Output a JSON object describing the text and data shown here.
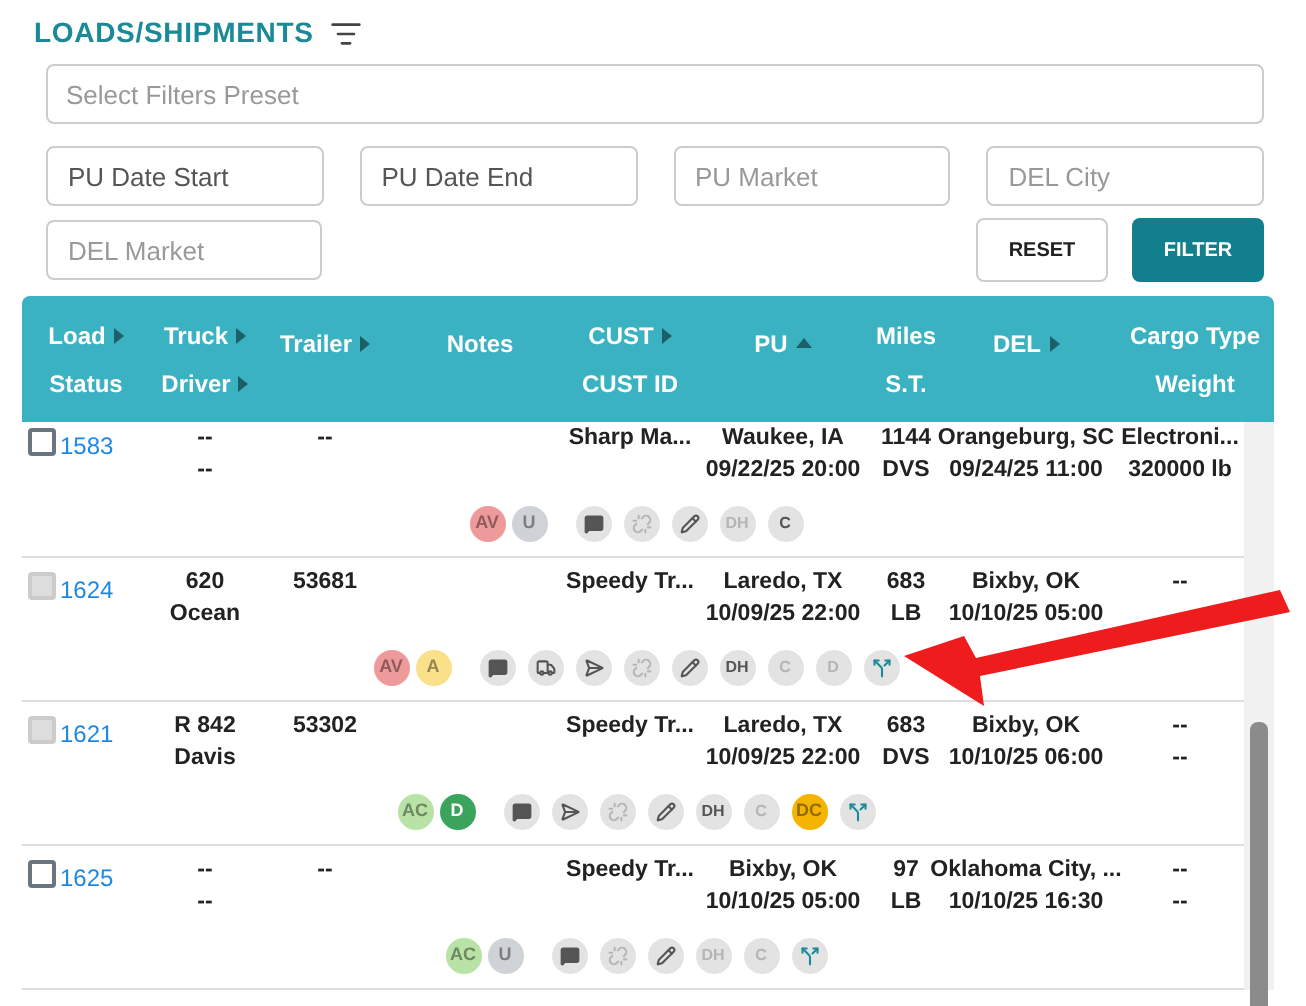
{
  "title": "LOADS/SHIPMENTS",
  "filters": {
    "preset": {
      "placeholder": "Select Filters Preset"
    },
    "fields": [
      {
        "value": "PU Date Start"
      },
      {
        "value": "PU Date End"
      },
      {
        "placeholder": "PU Market"
      },
      {
        "placeholder": "DEL City"
      },
      {
        "placeholder": "DEL Market"
      }
    ],
    "reset": "RESET",
    "filter": "FILTER"
  },
  "columns": [
    {
      "lines": [
        {
          "text": "Load",
          "sortable": true,
          "selected": false
        },
        {
          "text": "Status",
          "sortable": false,
          "selected": false
        }
      ]
    },
    {
      "lines": [
        {
          "text": "Truck",
          "sortable": true,
          "selected": false
        },
        {
          "text": "Driver",
          "sortable": true,
          "selected": false
        }
      ]
    },
    {
      "lines": [
        {
          "text": "Trailer",
          "sortable": true,
          "selected": false
        }
      ]
    },
    {
      "lines": [
        {
          "text": "Notes",
          "sortable": false,
          "selected": false
        }
      ]
    },
    {
      "lines": [
        {
          "text": "CUST",
          "sortable": true,
          "selected": false
        },
        {
          "text": "CUST ID",
          "sortable": false,
          "selected": false
        }
      ]
    },
    {
      "lines": [
        {
          "text": "PU",
          "sortable": true,
          "selected": true
        }
      ]
    },
    {
      "lines": [
        {
          "text": "Miles",
          "sortable": false,
          "selected": false
        },
        {
          "text": "S.T.",
          "sortable": false,
          "selected": false
        }
      ]
    },
    {
      "lines": [
        {
          "text": "DEL",
          "sortable": true,
          "selected": false
        }
      ]
    },
    {
      "lines": [
        {
          "text": "Cargo Type",
          "sortable": false,
          "selected": false
        },
        {
          "text": "Weight",
          "sortable": false,
          "selected": false
        }
      ]
    }
  ],
  "rows": [
    {
      "load": "1583",
      "disabled": false,
      "truck": [
        "--",
        "--"
      ],
      "trailer": [
        "--"
      ],
      "cust": "Sharp Ma...",
      "pu": [
        "Waukee, IA",
        "09/22/25 20:00"
      ],
      "miles": [
        "1144",
        "DVS"
      ],
      "del": [
        "Orangeburg, SC",
        "09/24/25 11:00"
      ],
      "cargo": [
        "Electroni...",
        "320000 lb"
      ],
      "statuses": [
        {
          "label": "AV",
          "color": "#ef9a9a"
        },
        {
          "label": "U",
          "color": "#cfd2d6"
        }
      ],
      "actions": [
        {
          "kind": "message",
          "disabled": false
        },
        {
          "kind": "unlink",
          "disabled": true
        },
        {
          "kind": "edit",
          "disabled": false
        },
        {
          "kind": "text",
          "label": "DH",
          "disabled": true
        },
        {
          "kind": "text",
          "label": "C",
          "disabled": false
        }
      ]
    },
    {
      "load": "1624",
      "disabled": true,
      "truck": [
        "620",
        "Ocean"
      ],
      "trailer": [
        "53681"
      ],
      "cust": "Speedy Tr...",
      "pu": [
        "Laredo, TX",
        "10/09/25 22:00"
      ],
      "miles": [
        "683",
        "LB"
      ],
      "del": [
        "Bixby, OK",
        "10/10/25 05:00"
      ],
      "cargo": [
        "--"
      ],
      "statuses": [
        {
          "label": "AV",
          "color": "#ef9a9a"
        },
        {
          "label": "A",
          "color": "#fbe08a"
        }
      ],
      "actions": [
        {
          "kind": "message",
          "disabled": false
        },
        {
          "kind": "truck",
          "disabled": false
        },
        {
          "kind": "send",
          "disabled": false
        },
        {
          "kind": "unlink",
          "disabled": true
        },
        {
          "kind": "edit",
          "disabled": false
        },
        {
          "kind": "text",
          "label": "DH",
          "disabled": false
        },
        {
          "kind": "text",
          "label": "C",
          "disabled": true
        },
        {
          "kind": "text",
          "label": "D",
          "disabled": true
        },
        {
          "kind": "split",
          "disabled": false
        }
      ]
    },
    {
      "load": "1621",
      "disabled": true,
      "truck": [
        "R 842",
        "Davis"
      ],
      "trailer": [
        "53302"
      ],
      "cust": "Speedy Tr...",
      "pu": [
        "Laredo, TX",
        "10/09/25 22:00"
      ],
      "miles": [
        "683",
        "DVS"
      ],
      "del": [
        "Bixby, OK",
        "10/10/25 06:00"
      ],
      "cargo": [
        "--",
        "--"
      ],
      "statuses": [
        {
          "label": "AC",
          "color": "#b9e2a5"
        },
        {
          "label": "D",
          "color": "#3aa35c"
        }
      ],
      "actions": [
        {
          "kind": "message",
          "disabled": false
        },
        {
          "kind": "send",
          "disabled": false
        },
        {
          "kind": "unlink",
          "disabled": true
        },
        {
          "kind": "edit",
          "disabled": false
        },
        {
          "kind": "text",
          "label": "DH",
          "disabled": false
        },
        {
          "kind": "text",
          "label": "C",
          "disabled": true
        },
        {
          "kind": "status",
          "label": "DC",
          "color": "#f5b400"
        },
        {
          "kind": "split",
          "disabled": false
        }
      ]
    },
    {
      "load": "1625",
      "disabled": false,
      "truck": [
        "--",
        "--"
      ],
      "trailer": [
        "--"
      ],
      "cust": "Speedy Tr...",
      "pu": [
        "Bixby, OK",
        "10/10/25 05:00"
      ],
      "miles": [
        "97",
        "LB"
      ],
      "del": [
        "Oklahoma City, ...",
        "10/10/25 16:30"
      ],
      "cargo": [
        "--",
        "--"
      ],
      "statuses": [
        {
          "label": "AC",
          "color": "#b9e2a5"
        },
        {
          "label": "U",
          "color": "#cfd2d6"
        }
      ],
      "actions": [
        {
          "kind": "message",
          "disabled": false
        },
        {
          "kind": "unlink",
          "disabled": true
        },
        {
          "kind": "edit",
          "disabled": false
        },
        {
          "kind": "text",
          "label": "DH",
          "disabled": true
        },
        {
          "kind": "text",
          "label": "C",
          "disabled": true
        },
        {
          "kind": "split",
          "disabled": false
        }
      ]
    }
  ]
}
